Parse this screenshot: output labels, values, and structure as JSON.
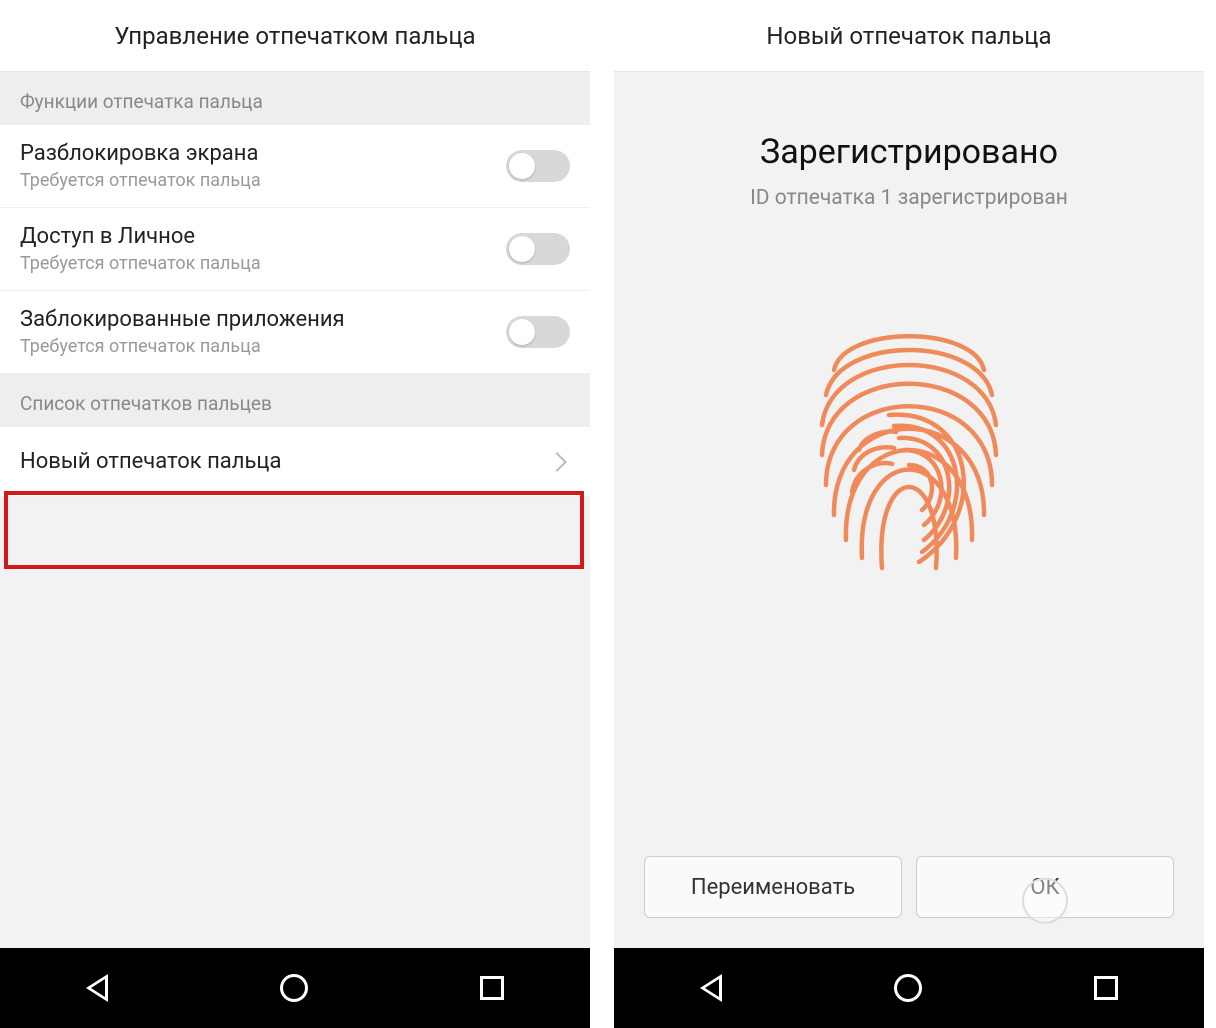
{
  "left": {
    "header_title": "Управление отпечатком пальца",
    "section_functions": "Функции отпечатка пальца",
    "items": [
      {
        "title": "Разблокировка экрана",
        "sub": "Требуется отпечаток пальца"
      },
      {
        "title": "Доступ в Личное",
        "sub": "Требуется отпечаток пальца"
      },
      {
        "title": "Заблокированные приложения",
        "sub": "Требуется отпечаток пальца"
      }
    ],
    "section_list": "Список отпечатков пальцев",
    "new_fp": "Новый отпечаток пальца"
  },
  "right": {
    "header_title": "Новый отпечаток пальца",
    "registered_title": "Зарегистрировано",
    "registered_sub": "ID отпечатка 1 зарегистрирован",
    "btn_rename": "Переименовать",
    "btn_ok": "ОК"
  },
  "colors": {
    "highlight": "#d11a1a",
    "fingerprint": "#f08a5a"
  }
}
